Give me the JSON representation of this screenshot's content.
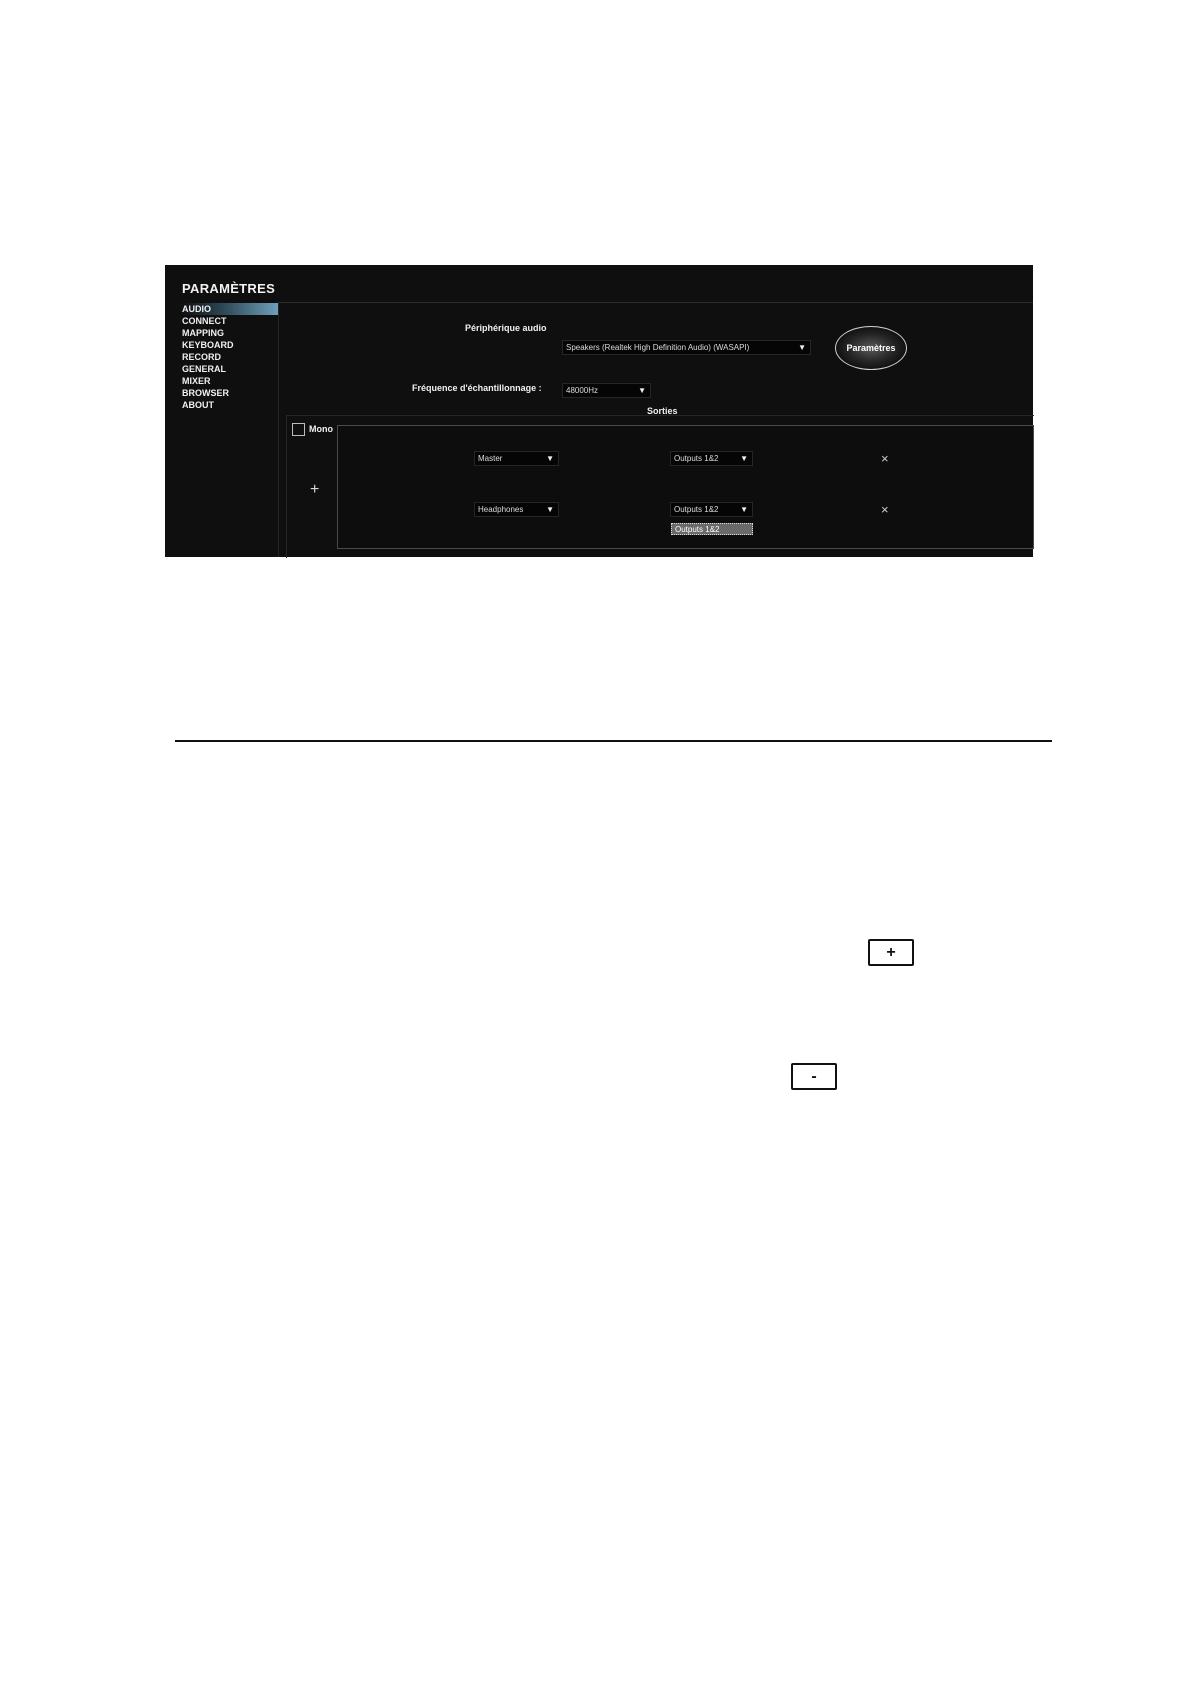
{
  "window": {
    "title": "PARAMÈTRES"
  },
  "sidebar": {
    "items": [
      {
        "label": "AUDIO",
        "active": true
      },
      {
        "label": "CONNECT"
      },
      {
        "label": "MAPPING"
      },
      {
        "label": "KEYBOARD"
      },
      {
        "label": "RECORD"
      },
      {
        "label": "GENERAL"
      },
      {
        "label": "MIXER"
      },
      {
        "label": "BROWSER"
      },
      {
        "label": "ABOUT"
      }
    ]
  },
  "audio": {
    "device_label": "Périphérique audio",
    "device_value": "Speakers (Realtek High Definition Audio) (WASAPI)",
    "settings_button": "Paramètres",
    "sample_rate_label": "Fréquence d'échantillonnage :",
    "sample_rate_value": "48000Hz",
    "outputs_label": "Sorties",
    "mono_label": "Mono",
    "add_symbol": "+",
    "rows": [
      {
        "channel": "Master",
        "output": "Outputs 1&2",
        "remove": "×"
      },
      {
        "channel": "Headphones",
        "output": "Outputs 1&2",
        "remove": "×"
      }
    ],
    "dropdown_option": "Outputs 1&2"
  },
  "icons": {
    "dropdown": "▼",
    "plus_key": "+",
    "minus_key": "-"
  }
}
